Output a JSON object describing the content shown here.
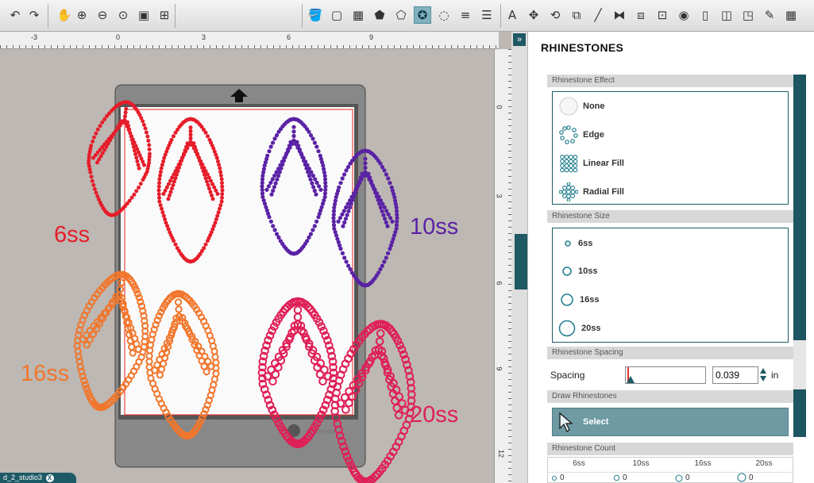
{
  "toolbar": {
    "icons": [
      "undo-icon",
      "redo-icon",
      "pan-icon",
      "zoom-in-icon",
      "zoom-out-icon",
      "zoom-select-icon",
      "fit-page-icon",
      "fit-all-icon",
      "paint-bucket-icon",
      "fill-color-icon",
      "fill-pattern-icon",
      "pentagon-icon",
      "rhinestone-icon",
      "rhinestone-active-icon",
      "offset-icon",
      "line-color-icon",
      "line-style-icon",
      "text-icon",
      "transform-icon",
      "rotate-icon",
      "scale-icon",
      "draw-line-icon",
      "group-icon",
      "ungroup-icon",
      "design-store-icon",
      "trace-icon",
      "page-setup-icon",
      "cut-settings-icon",
      "send-icon",
      "sketch-icon",
      "grid-icon"
    ],
    "active_icon": "rhinestone-active-icon"
  },
  "rulers": {
    "h_ticks": [
      "-3",
      "0",
      "3",
      "6",
      "9"
    ],
    "v_ticks": [
      "0",
      "3",
      "6",
      "9",
      "12"
    ]
  },
  "canvas": {
    "labels": {
      "l6": "6ss",
      "l10": "10ss",
      "l16": "16ss",
      "l20": "20ss"
    },
    "mat_logo": "silhouette"
  },
  "colors": {
    "six": "#e61d2a",
    "ten": "#5a22a5",
    "sixteen": "#f1762c",
    "twenty": "#df1f57",
    "accent": "#1e5b66"
  },
  "panel": {
    "title": "RHINESTONES",
    "effect_header": "Rhinestone Effect",
    "effects": [
      "None",
      "Edge",
      "Linear Fill",
      "Radial Fill"
    ],
    "size_header": "Rhinestone Size",
    "sizes": [
      "6ss",
      "10ss",
      "16ss",
      "20ss"
    ],
    "spacing_header": "Rhinestone Spacing",
    "spacing_label": "Spacing",
    "spacing_value": "0.039",
    "spacing_unit": "in",
    "draw_header": "Draw Rhinestones",
    "draw_button": "Select",
    "count_header": "Rhinestone Count",
    "count_cols": [
      "6ss",
      "10ss",
      "16ss",
      "20ss"
    ],
    "count_vals": [
      "0",
      "0",
      "0",
      "0"
    ]
  },
  "status": {
    "tab_label": "d_2_studio3",
    "close": "X"
  }
}
